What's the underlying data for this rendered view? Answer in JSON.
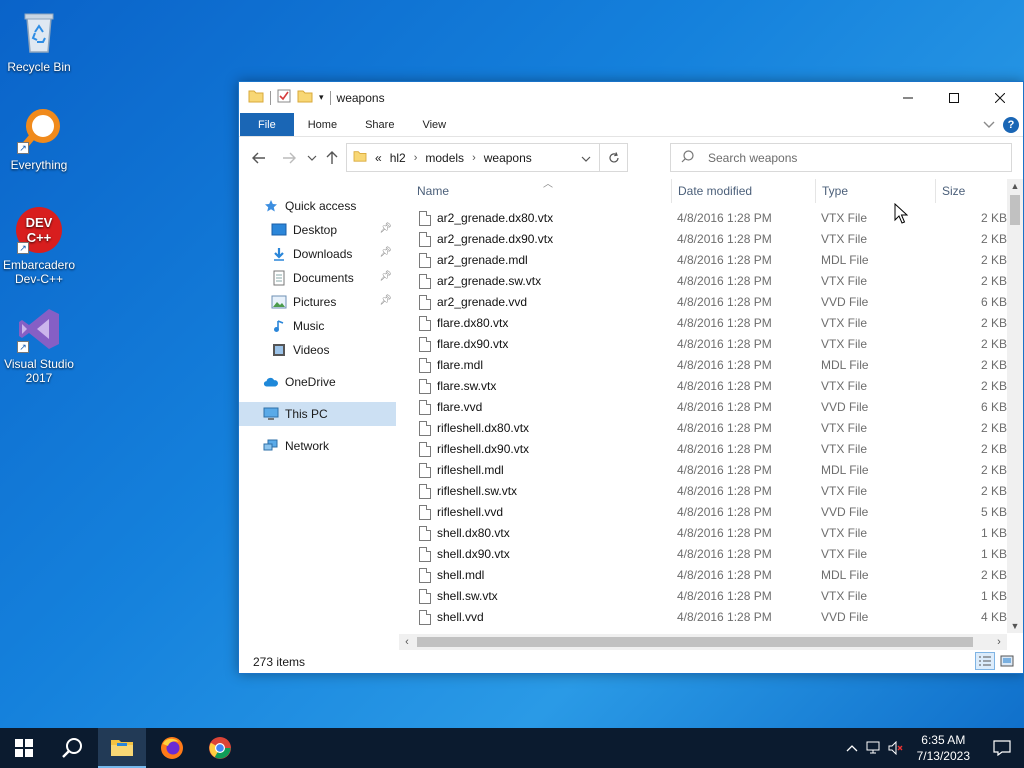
{
  "desktop": {
    "icons": [
      {
        "label": "Recycle Bin"
      },
      {
        "label": "Everything"
      },
      {
        "label": "Embarcadero Dev-C++"
      },
      {
        "label": "Visual Studio 2017"
      }
    ],
    "devcpp_logo_text": "DEV C++"
  },
  "window": {
    "title": "weapons",
    "controls": {
      "minimize": "—",
      "maximize": "☐",
      "close": "✕"
    }
  },
  "ribbon": {
    "tabs": [
      "File",
      "Home",
      "Share",
      "View"
    ]
  },
  "address": {
    "overflow": "«",
    "crumbs": [
      "hl2",
      "models",
      "weapons"
    ]
  },
  "search": {
    "placeholder": "Search weapons"
  },
  "navpane": {
    "items": [
      {
        "label": "Quick access",
        "icon": "star-icon"
      },
      {
        "label": "Desktop",
        "icon": "desktop-folder-icon",
        "pinned": true
      },
      {
        "label": "Downloads",
        "icon": "downloads-icon",
        "pinned": true
      },
      {
        "label": "Documents",
        "icon": "documents-icon",
        "pinned": true
      },
      {
        "label": "Pictures",
        "icon": "pictures-icon",
        "pinned": true
      },
      {
        "label": "Music",
        "icon": "music-icon"
      },
      {
        "label": "Videos",
        "icon": "videos-icon"
      },
      {
        "label": "OneDrive",
        "icon": "cloud-icon"
      },
      {
        "label": "This PC",
        "icon": "computer-icon",
        "selected": true
      },
      {
        "label": "Network",
        "icon": "network-icon"
      }
    ]
  },
  "columns": {
    "name": "Name",
    "date": "Date modified",
    "type": "Type",
    "size": "Size"
  },
  "files": [
    {
      "name": "ar2_grenade.dx80.vtx",
      "date": "4/8/2016 1:28 PM",
      "type": "VTX File",
      "size": "2 KB"
    },
    {
      "name": "ar2_grenade.dx90.vtx",
      "date": "4/8/2016 1:28 PM",
      "type": "VTX File",
      "size": "2 KB"
    },
    {
      "name": "ar2_grenade.mdl",
      "date": "4/8/2016 1:28 PM",
      "type": "MDL File",
      "size": "2 KB"
    },
    {
      "name": "ar2_grenade.sw.vtx",
      "date": "4/8/2016 1:28 PM",
      "type": "VTX File",
      "size": "2 KB"
    },
    {
      "name": "ar2_grenade.vvd",
      "date": "4/8/2016 1:28 PM",
      "type": "VVD File",
      "size": "6 KB"
    },
    {
      "name": "flare.dx80.vtx",
      "date": "4/8/2016 1:28 PM",
      "type": "VTX File",
      "size": "2 KB"
    },
    {
      "name": "flare.dx90.vtx",
      "date": "4/8/2016 1:28 PM",
      "type": "VTX File",
      "size": "2 KB"
    },
    {
      "name": "flare.mdl",
      "date": "4/8/2016 1:28 PM",
      "type": "MDL File",
      "size": "2 KB"
    },
    {
      "name": "flare.sw.vtx",
      "date": "4/8/2016 1:28 PM",
      "type": "VTX File",
      "size": "2 KB"
    },
    {
      "name": "flare.vvd",
      "date": "4/8/2016 1:28 PM",
      "type": "VVD File",
      "size": "6 KB"
    },
    {
      "name": "rifleshell.dx80.vtx",
      "date": "4/8/2016 1:28 PM",
      "type": "VTX File",
      "size": "2 KB"
    },
    {
      "name": "rifleshell.dx90.vtx",
      "date": "4/8/2016 1:28 PM",
      "type": "VTX File",
      "size": "2 KB"
    },
    {
      "name": "rifleshell.mdl",
      "date": "4/8/2016 1:28 PM",
      "type": "MDL File",
      "size": "2 KB"
    },
    {
      "name": "rifleshell.sw.vtx",
      "date": "4/8/2016 1:28 PM",
      "type": "VTX File",
      "size": "2 KB"
    },
    {
      "name": "rifleshell.vvd",
      "date": "4/8/2016 1:28 PM",
      "type": "VVD File",
      "size": "5 KB"
    },
    {
      "name": "shell.dx80.vtx",
      "date": "4/8/2016 1:28 PM",
      "type": "VTX File",
      "size": "1 KB"
    },
    {
      "name": "shell.dx90.vtx",
      "date": "4/8/2016 1:28 PM",
      "type": "VTX File",
      "size": "1 KB"
    },
    {
      "name": "shell.mdl",
      "date": "4/8/2016 1:28 PM",
      "type": "MDL File",
      "size": "2 KB"
    },
    {
      "name": "shell.sw.vtx",
      "date": "4/8/2016 1:28 PM",
      "type": "VTX File",
      "size": "1 KB"
    },
    {
      "name": "shell.vvd",
      "date": "4/8/2016 1:28 PM",
      "type": "VVD File",
      "size": "4 KB"
    }
  ],
  "status": {
    "item_count": "273 items"
  },
  "taskbar": {
    "time": "6:35 AM",
    "date": "7/13/2023"
  },
  "colors": {
    "accent": "#1a66b5",
    "selection": "#cce0f3",
    "taskbar": "#0b1b2f"
  }
}
